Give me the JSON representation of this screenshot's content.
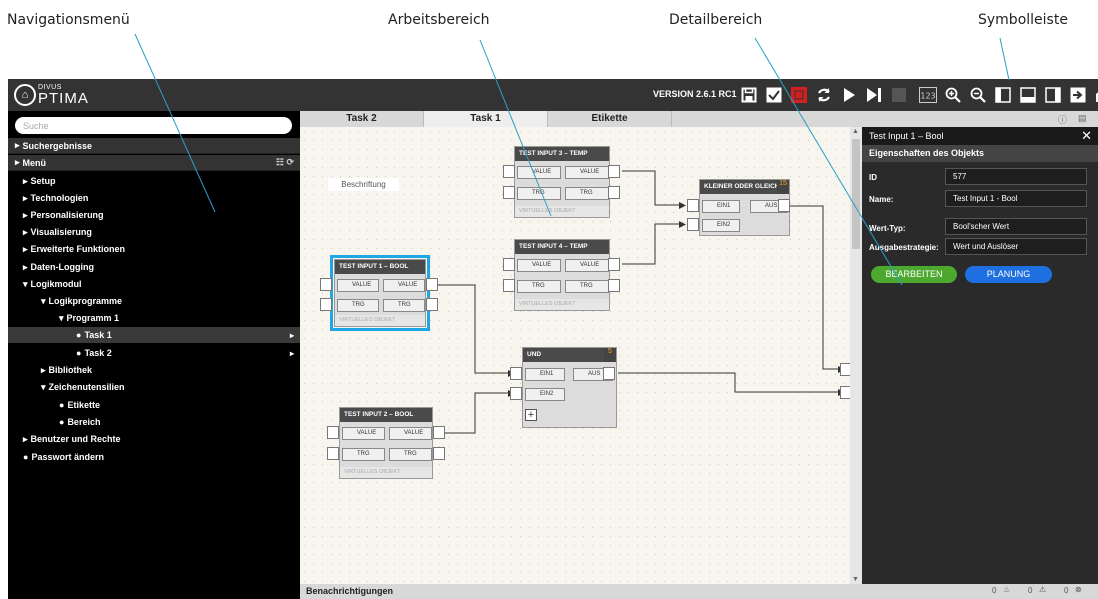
{
  "annotations": {
    "nav": "Navigationsmenü",
    "work": "Arbeitsbereich",
    "detail": "Detailbereich",
    "toolbar": "Symbolleiste"
  },
  "app": {
    "logo_small": "DIVUS",
    "logo_big": "PTIMA",
    "version": "VERSION 2.6.1 RC1"
  },
  "toolbar_icons": [
    "save-icon",
    "import-icon",
    "delete-icon",
    "refresh-icon",
    "play-icon",
    "step-icon",
    "stop-icon",
    "numbers-icon",
    "zoom-in-icon",
    "zoom-out-icon",
    "panel-left-icon",
    "panel-bottom-icon",
    "panel-right-icon",
    "export-icon",
    "home-icon"
  ],
  "toolbar_number_label": "123",
  "nav": {
    "search_placeholder": "Suche",
    "search_results": "Suchergebnisse",
    "menu": "Menü",
    "items": [
      "Setup",
      "Technologien",
      "Personalisierung",
      "Visualisierung",
      "Erweiterte Funktionen",
      "Daten-Logging",
      "Logikmodul",
      "Logikprogramme",
      "Programm 1",
      "Task 1",
      "Task 2",
      "Bibliothek",
      "Zeichenutensilien",
      "Etikette",
      "Bereich",
      "Benutzer und Rechte",
      "Passwort ändern"
    ]
  },
  "tabs": [
    "Task 2",
    "Task 1",
    "Etikette"
  ],
  "workspace": {
    "label_box": "Beschriftung",
    "blocks": [
      {
        "title": "TEST INPUT 3 – TEMP",
        "in1": "VALUE",
        "out1": "VALUE",
        "in2": "TRG",
        "out2": "TRG",
        "footer": "VIRTUELLES OBJEKT"
      },
      {
        "title": "TEST INPUT 4 – TEMP",
        "in1": "VALUE",
        "out1": "VALUE",
        "in2": "TRG",
        "out2": "TRG",
        "footer": "VIRTUELLES OBJEKT"
      },
      {
        "title": "TEST INPUT 1 – BOOL",
        "in1": "VALUE",
        "out1": "VALUE",
        "in2": "TRG",
        "out2": "TRG",
        "footer": "VIRTUELLES OBJEKT"
      },
      {
        "title": "TEST INPUT 2 – BOOL",
        "in1": "VALUE",
        "out1": "VALUE",
        "in2": "TRG",
        "out2": "TRG",
        "footer": "VIRTUELLES OBJEKT"
      }
    ],
    "gate_compare": {
      "title": "KLEINER ODER GLEICH",
      "num": "15",
      "in1": "EIN1",
      "in2": "EIN2",
      "out": "AUS"
    },
    "gate_and": {
      "title": "UND",
      "num": "5",
      "in1": "EIN1",
      "in2": "EIN2",
      "out": "AUS"
    }
  },
  "notifications": {
    "label": "Benachrichtigungen",
    "count1": "0",
    "count2": "0",
    "count3": "0"
  },
  "detail": {
    "title": "Test Input 1 – Bool",
    "section": "Eigenschaften des Objekts",
    "props": [
      {
        "label": "ID",
        "value": "577"
      },
      {
        "label": "Name:",
        "value": "Test Input 1 - Bool"
      },
      {
        "label": "Wert-Typ:",
        "value": "Bool'scher Wert"
      },
      {
        "label": "Ausgabestrategie:",
        "value": "Wert und Auslöser"
      }
    ],
    "edit_button": "BEARBEITEN",
    "plan_button": "PLANUNG",
    "edit_color": "#4ca82e",
    "plan_color": "#1e6fe0"
  }
}
